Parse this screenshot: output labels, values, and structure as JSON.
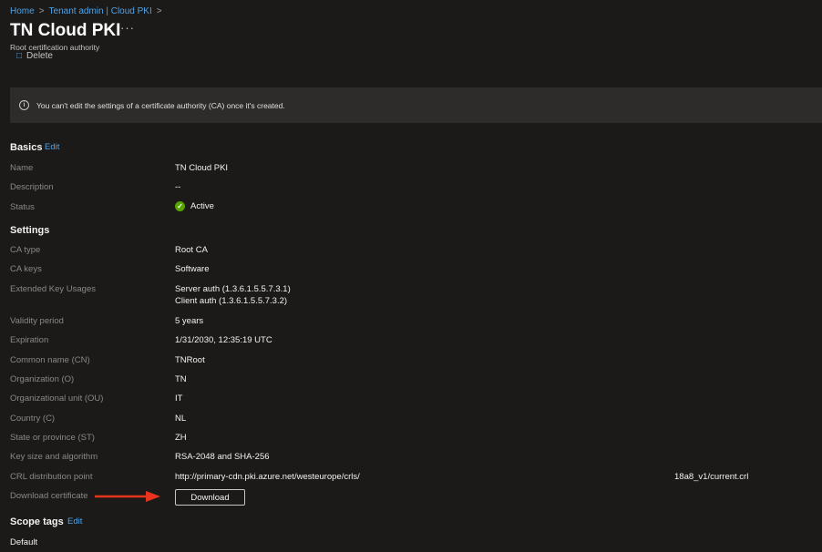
{
  "breadcrumb": [
    {
      "label": "Home"
    },
    {
      "label": "Tenant admin | Cloud PKI"
    }
  ],
  "header": {
    "title": "TN Cloud PKI",
    "more_label": "···",
    "subtitle": "Root certification authority",
    "delete_label": "Delete"
  },
  "info": {
    "message": "You can't edit the settings of a certificate authority (CA) once it's created."
  },
  "basics": {
    "heading": "Basics",
    "edit_label": "Edit",
    "name_label": "Name",
    "name_value": "TN Cloud PKI",
    "description_label": "Description",
    "description_value": "--",
    "status_label": "Status",
    "status_value": "Active",
    "status_color": "#57a300"
  },
  "settings": {
    "heading": "Settings",
    "ca_type_label": "CA type",
    "ca_type_value": "Root CA",
    "ca_keys_label": "CA keys",
    "ca_keys_value": "Software",
    "eku_label": "Extended Key Usages",
    "eku_value_1": "Server auth (1.3.6.1.5.5.7.3.1)",
    "eku_value_2": "Client auth (1.3.6.1.5.5.7.3.2)",
    "validity_label": "Validity period",
    "validity_value": "5 years",
    "expiration_label": "Expiration",
    "expiration_value": "1/31/2030, 12:35:19 UTC",
    "cn_label": "Common name (CN)",
    "cn_value": "TNRoot",
    "org_label": "Organization (O)",
    "org_value": "TN",
    "ou_label": "Organizational unit (OU)",
    "ou_value": "IT",
    "country_label": "Country (C)",
    "country_value": "NL",
    "state_label": "State or province (ST)",
    "state_value": "ZH",
    "key_label": "Key size and algorithm",
    "key_value": "RSA-2048 and SHA-256",
    "crl_label": "CRL distribution point",
    "crl_value_start": "http://primary-cdn.pki.azure.net/westeurope/crls/",
    "crl_value_end": "18a8_v1/current.crl",
    "download_label": "Download certificate",
    "download_button": "Download"
  },
  "scope": {
    "heading": "Scope tags",
    "edit_label": "Edit",
    "value": "Default"
  },
  "colors": {
    "accent": "#4fa3e8",
    "annotation_arrow": "#e8341c"
  },
  "icons": {
    "info": "info-circle-icon",
    "status": "checkmark-circle-icon",
    "delete": "trash-icon",
    "arrow": "red-arrow-right-icon"
  }
}
